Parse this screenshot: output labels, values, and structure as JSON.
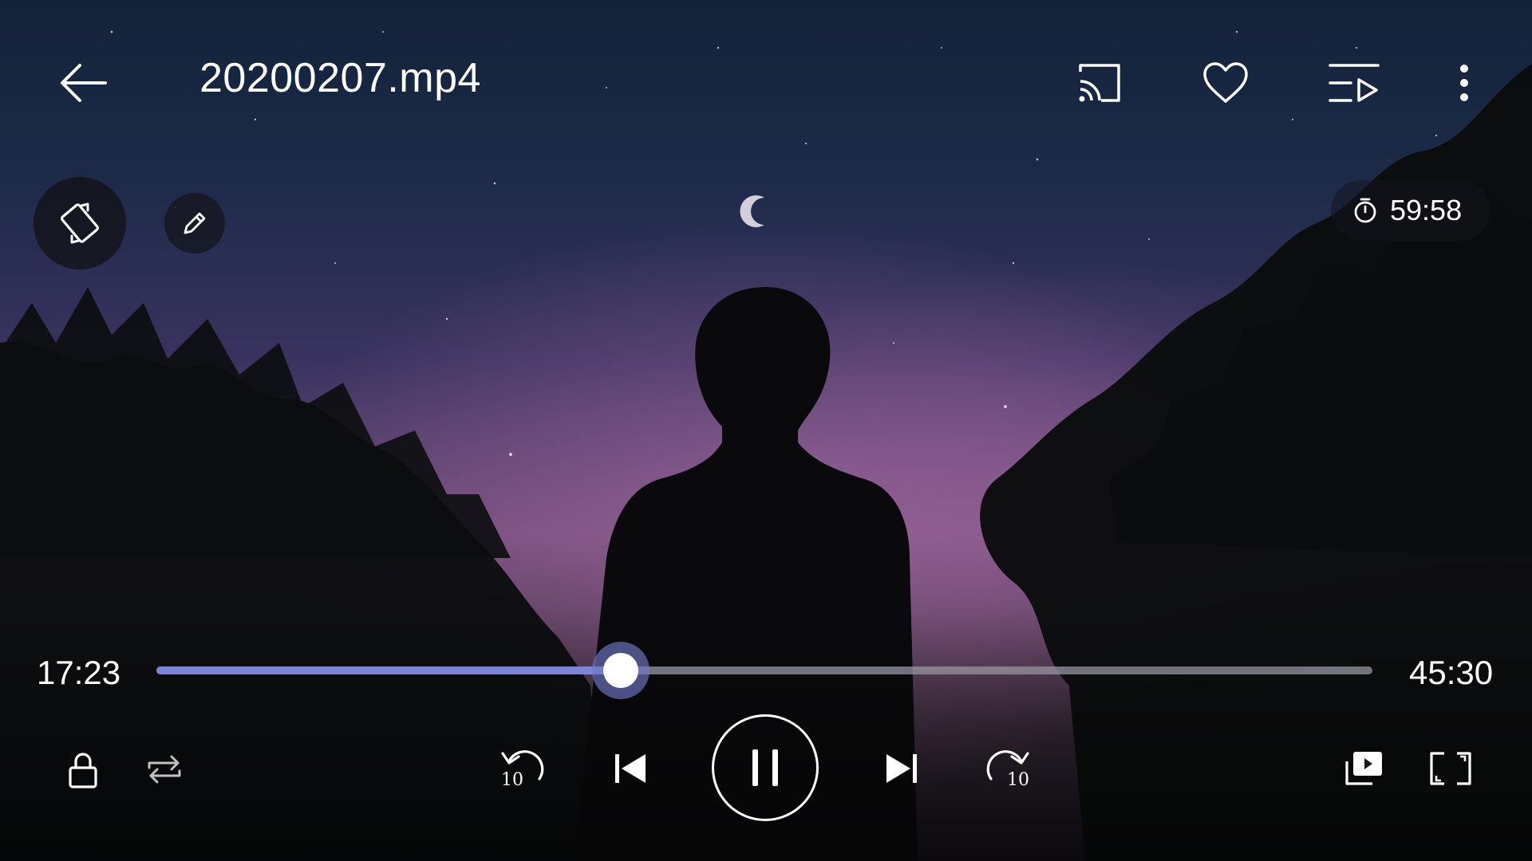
{
  "header": {
    "file_title": "20200207.mp4",
    "icons": [
      "back-arrow-icon",
      "cast-icon",
      "heart-icon",
      "playlist-icon",
      "more-vertical-icon"
    ]
  },
  "overlay": {
    "icons": [
      "rotate-screen-icon",
      "edit-pencil-icon"
    ],
    "sleep_timer": {
      "icon": "timer-icon",
      "value": "59:58"
    }
  },
  "playback": {
    "current_time": "17:23",
    "total_time": "45:30",
    "progress_fraction": 0.382,
    "accent_color": "#7b84d9"
  },
  "controls": {
    "rewind_seconds": "10",
    "forward_seconds": "10",
    "icons": [
      "lock-icon",
      "repeat-icon",
      "rewind-10-icon",
      "previous-track-icon",
      "pause-icon",
      "next-track-icon",
      "forward-10-icon",
      "popup-play-icon",
      "fullscreen-icon"
    ]
  }
}
